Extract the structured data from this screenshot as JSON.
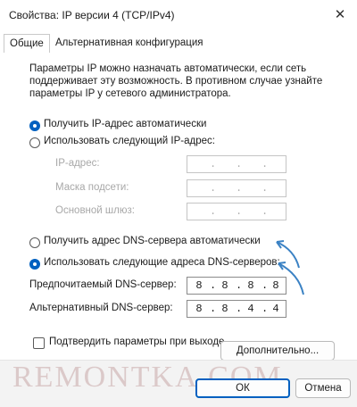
{
  "window": {
    "title": "Свойства: IP версии 4 (TCP/IPv4)",
    "close_icon": "close-icon"
  },
  "tabs": [
    {
      "label": "Общие",
      "active": true
    },
    {
      "label": "Альтернативная конфигурация",
      "active": false
    }
  ],
  "description": "Параметры IP можно назначать автоматически, если сеть поддерживает эту возможность. В противном случае узнайте параметры IP у сетевого администратора.",
  "ip": {
    "auto_label": "Получить IP-адрес автоматически",
    "auto_selected": true,
    "manual_label": "Использовать следующий IP-адрес:",
    "manual_selected": false,
    "fields": [
      {
        "label": "IP-адрес:",
        "value": [
          "",
          "",
          "",
          ""
        ]
      },
      {
        "label": "Маска подсети:",
        "value": [
          "",
          "",
          "",
          ""
        ]
      },
      {
        "label": "Основной шлюз:",
        "value": [
          "",
          "",
          "",
          ""
        ]
      }
    ]
  },
  "dns": {
    "auto_label": "Получить адрес DNS-сервера автоматически",
    "auto_selected": false,
    "manual_label": "Использовать следующие адреса DNS-серверов:",
    "manual_selected": true,
    "fields": [
      {
        "label": "Предпочитаемый DNS-сервер:",
        "value": [
          "8",
          "8",
          "8",
          "8"
        ]
      },
      {
        "label": "Альтернативный DNS-сервер:",
        "value": [
          "8",
          "8",
          "4",
          "4"
        ]
      }
    ]
  },
  "validate": {
    "label": "Подтвердить параметры при выходе",
    "checked": false
  },
  "buttons": {
    "advanced": "Дополнительно...",
    "ok": "ОК",
    "cancel": "Отмена"
  },
  "watermark": "REMONTKA.COM",
  "colors": {
    "accent": "#0060c0",
    "arrow": "#3b82c4"
  }
}
